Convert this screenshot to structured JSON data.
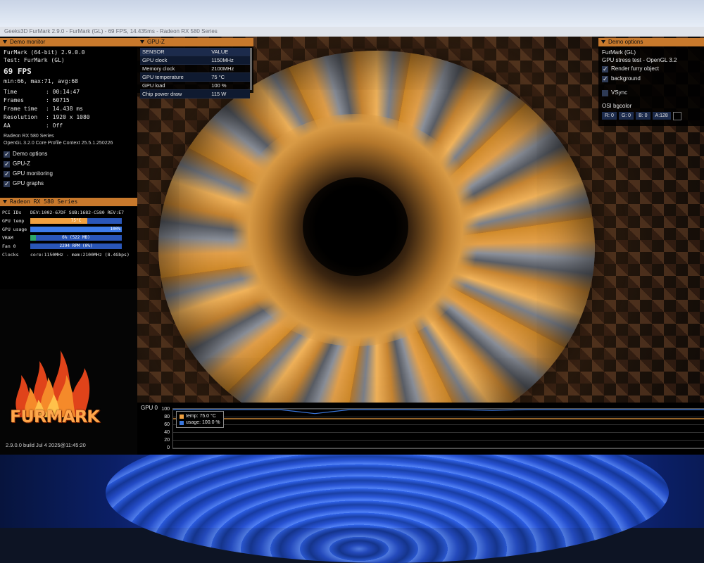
{
  "window": {
    "title": "Geeks3D FurMark 2.9.0 - FurMark (GL) - 69 FPS, 14.435ms - Radeon RX 580 Series"
  },
  "demo_monitor": {
    "header": "Demo monitor",
    "app_version": "FurMark (64-bit) 2.9.0.0",
    "test": "Test: FurMark (GL)",
    "fps": "69 FPS",
    "fps_stats": "min:66, max:71, avg:68",
    "stats": [
      {
        "key": "Time",
        "value": ": 00:14:47"
      },
      {
        "key": "Frames",
        "value": ": 60715"
      },
      {
        "key": "Frame time",
        "value": ": 14.438 ms"
      },
      {
        "key": "Resolution",
        "value": ": 1920 x 1080"
      },
      {
        "key": "AA",
        "value": ": Off"
      }
    ],
    "gpu_name": "Radeon RX 580 Series",
    "opengl": "OpenGL 3.2.0 Core Profile Context 25.5.1.250226",
    "checkboxes": [
      {
        "label": "Demo options",
        "checked": true
      },
      {
        "label": "GPU-Z",
        "checked": true
      },
      {
        "label": "GPU monitoring",
        "checked": true
      },
      {
        "label": "GPU graphs",
        "checked": true
      }
    ]
  },
  "radeon": {
    "header": "Radeon RX 580 Series",
    "pci_label": "PCI IDs",
    "pci_value": "DEV:1002-67DF SUB:1682-C580 REV:E7",
    "gpu_temp_label": "GPU temp",
    "gpu_temp_value": "75°C",
    "gpu_temp_fraction": 0.62,
    "gpu_usage_label": "GPU usage",
    "gpu_usage_value": "100%",
    "gpu_usage_fraction": 1.0,
    "vram_label": "VRAM",
    "vram_value": "6% (522 MB)",
    "vram_fraction": 0.06,
    "fan_label": "Fan 0",
    "fan_value": "2294 RPM (0%)",
    "fan_fraction": 0.0,
    "clocks_label": "Clocks",
    "clocks_value": "core:1150MHz - mem:2100MHz (8.4Gbps)"
  },
  "gpuz": {
    "header": "GPU-Z",
    "col_sensor": "SENSOR",
    "col_value": "VALUE",
    "rows": [
      {
        "sensor": "GPU clock",
        "value": "1150MHz"
      },
      {
        "sensor": "Memory clock",
        "value": "2100MHz"
      },
      {
        "sensor": "GPU temperature",
        "value": "75 °C"
      },
      {
        "sensor": "GPU load",
        "value": "100 %"
      },
      {
        "sensor": "Chip power draw",
        "value": "115 W"
      }
    ]
  },
  "demo_options": {
    "header": "Demo options",
    "title": "FurMark (GL)",
    "subtitle": "GPU stress test - OpenGL 3.2",
    "render_furry": "Render furry object",
    "background": "background",
    "vsync": "VSync",
    "osi_label": "OSI bgcolor",
    "r": "R: 0",
    "g": "G: 0",
    "b": "B: 0",
    "a": "A:128"
  },
  "graph": {
    "title": "GPU 0",
    "y_ticks": [
      "100",
      "80",
      "60",
      "40",
      "20",
      "0"
    ],
    "legend_temp": "temp: 75.0 °C",
    "legend_usage": "usage: 100.0 %",
    "temp_color": "#f0a040",
    "usage_color": "#3a78e0"
  },
  "chart_data": {
    "type": "line",
    "title": "GPU 0",
    "ylim": [
      0,
      100
    ],
    "series": [
      {
        "name": "temp: 75.0 °C",
        "values": [
          75,
          75,
          75,
          75,
          75,
          75,
          75,
          75,
          75,
          75,
          75,
          75,
          75,
          75,
          75,
          75
        ]
      },
      {
        "name": "usage: 100.0 %",
        "values": [
          100,
          100,
          100,
          100,
          88,
          100,
          100,
          100,
          100,
          96,
          100,
          100,
          100,
          100,
          100,
          100
        ]
      }
    ]
  },
  "logo": {
    "text": "FURMARK",
    "build": "2.9.0.0 build Jul  4 2025@11:45:20"
  }
}
